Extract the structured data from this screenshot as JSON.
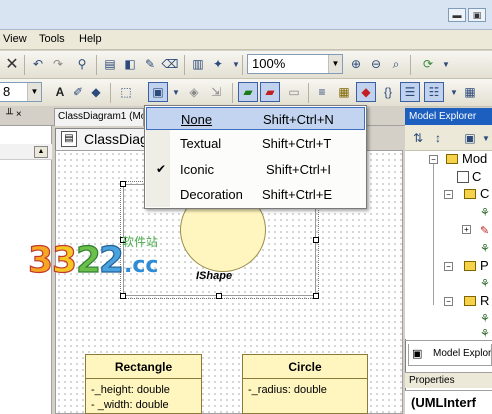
{
  "menubar": {
    "items": [
      "View",
      "Tools",
      "Help"
    ],
    "underline": [
      "V",
      "T",
      "H"
    ]
  },
  "toolbar": {
    "zoom": "100%",
    "combo_left": "8"
  },
  "tabs": {
    "pin_label": "╨ ×",
    "doc_tab": "ClassDiagram1 (Mo",
    "editor_tab": "ClassDiag"
  },
  "dropdown": {
    "items": [
      {
        "label": "None",
        "shortcut": "Shift+Ctrl+N",
        "checked": false,
        "highlighted": true
      },
      {
        "label": "Textual",
        "shortcut": "Shift+Ctrl+T",
        "checked": false,
        "highlighted": false
      },
      {
        "label": "Iconic",
        "shortcut": "Shift+Ctrl+I",
        "checked": true,
        "highlighted": false
      },
      {
        "label": "Decoration",
        "shortcut": "Shift+Ctrl+E",
        "checked": false,
        "highlighted": false
      }
    ]
  },
  "diagram": {
    "ishape_label": "IShape",
    "classes": [
      {
        "name": "Rectangle",
        "attributes": [
          "-_height: double",
          "- _width: double"
        ]
      },
      {
        "name": "Circle",
        "attributes": [
          "-_radius: double"
        ]
      }
    ]
  },
  "explorer": {
    "title": "Model Explorer",
    "tree_root": "Mod",
    "tree_items": [
      "C",
      "C",
      "P",
      "R"
    ],
    "bottom_tab": "Model Explor",
    "properties_title": "Properties",
    "properties_value": "(UMLInterf"
  },
  "watermark": {
    "text": "3322.cc",
    "cn": "软件站"
  },
  "colors": {
    "class_fill": "#fff6bf",
    "highlight": "#c2d4f0",
    "explorer_title": "#1c5fbf"
  }
}
